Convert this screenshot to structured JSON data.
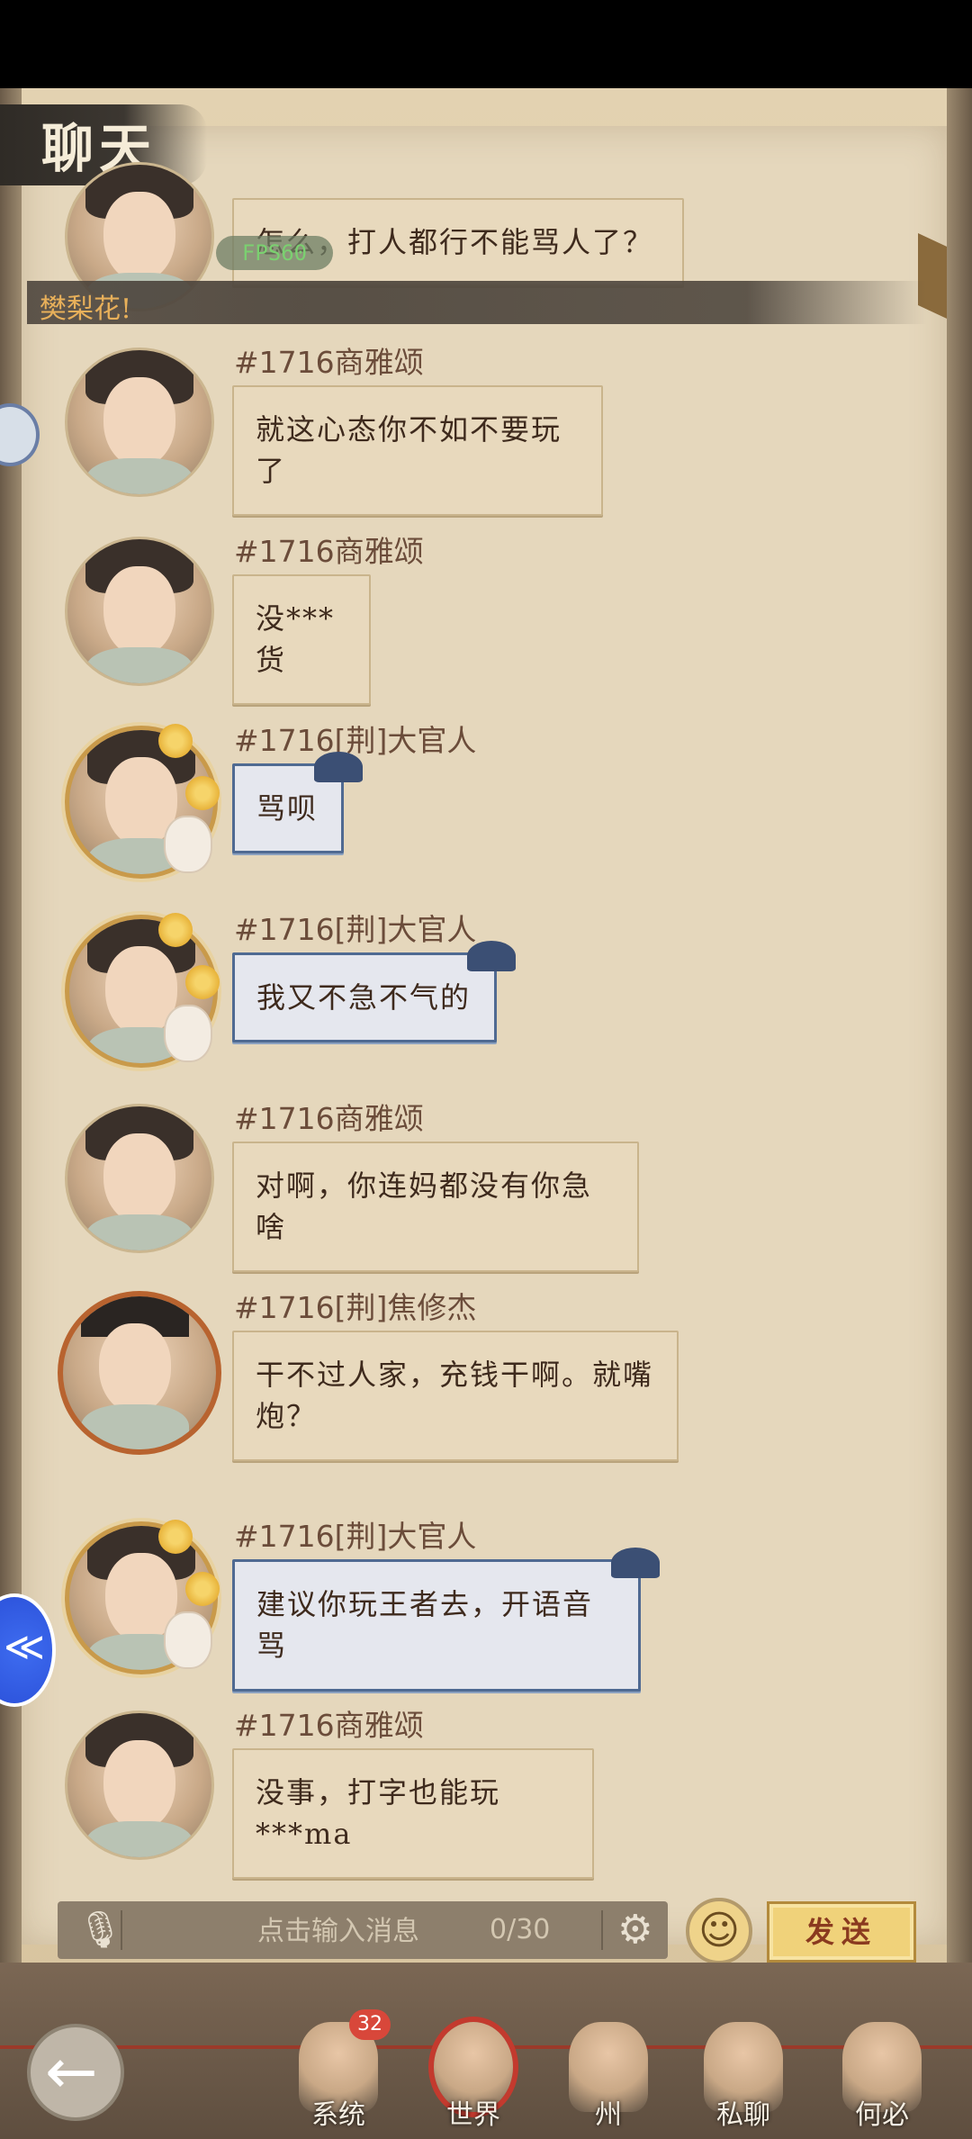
{
  "header": {
    "title": "聊天"
  },
  "banner": {
    "text": "樊梨花!"
  },
  "overlay": {
    "fps": "FPS60"
  },
  "messages": [
    {
      "sender": "",
      "text": "怎么，打人都行不能骂人了？",
      "style": "plain"
    },
    {
      "sender": "#1716商雅颂",
      "text": "就这心态你不如不要玩了",
      "style": "plain"
    },
    {
      "sender": "#1716商雅颂",
      "text": "没***货",
      "style": "plain"
    },
    {
      "sender": "#1716[荆]大官人",
      "text": "骂呗",
      "style": "blue"
    },
    {
      "sender": "#1716[荆]大官人",
      "text": "我又不急不气的",
      "style": "blue"
    },
    {
      "sender": "#1716商雅颂",
      "text": "对啊，你连妈都没有你急啥",
      "style": "plain"
    },
    {
      "sender": "#1716[荆]焦修杰",
      "text": "干不过人家，充钱干啊。就嘴炮？",
      "style": "plain"
    },
    {
      "sender": "#1716[荆]大官人",
      "text": "建议你玩王者去，开语音骂",
      "style": "blue"
    },
    {
      "sender": "#1716商雅颂",
      "text": "没事，打字也能玩***ma",
      "style": "plain"
    }
  ],
  "input": {
    "placeholder": "点击输入消息",
    "counter": "0/30",
    "send_label": "发送"
  },
  "icons": {
    "mic": "microphone-icon",
    "settings": "gear-icon",
    "emoji": "smiley-icon",
    "back": "back-arrow-icon"
  },
  "nav": {
    "items": [
      {
        "label": "系统",
        "badge": "32"
      },
      {
        "label": "世界"
      },
      {
        "label": "州"
      },
      {
        "label": "私聊"
      },
      {
        "label": "何必"
      }
    ]
  },
  "colors": {
    "paper": "#e5d7bc",
    "bubble": "#e8d9bd",
    "blue_bubble_border": "#4f6a92",
    "name_text": "#6b4c3a",
    "banner_text": "#e8b05a",
    "badge": "#d8473a"
  }
}
